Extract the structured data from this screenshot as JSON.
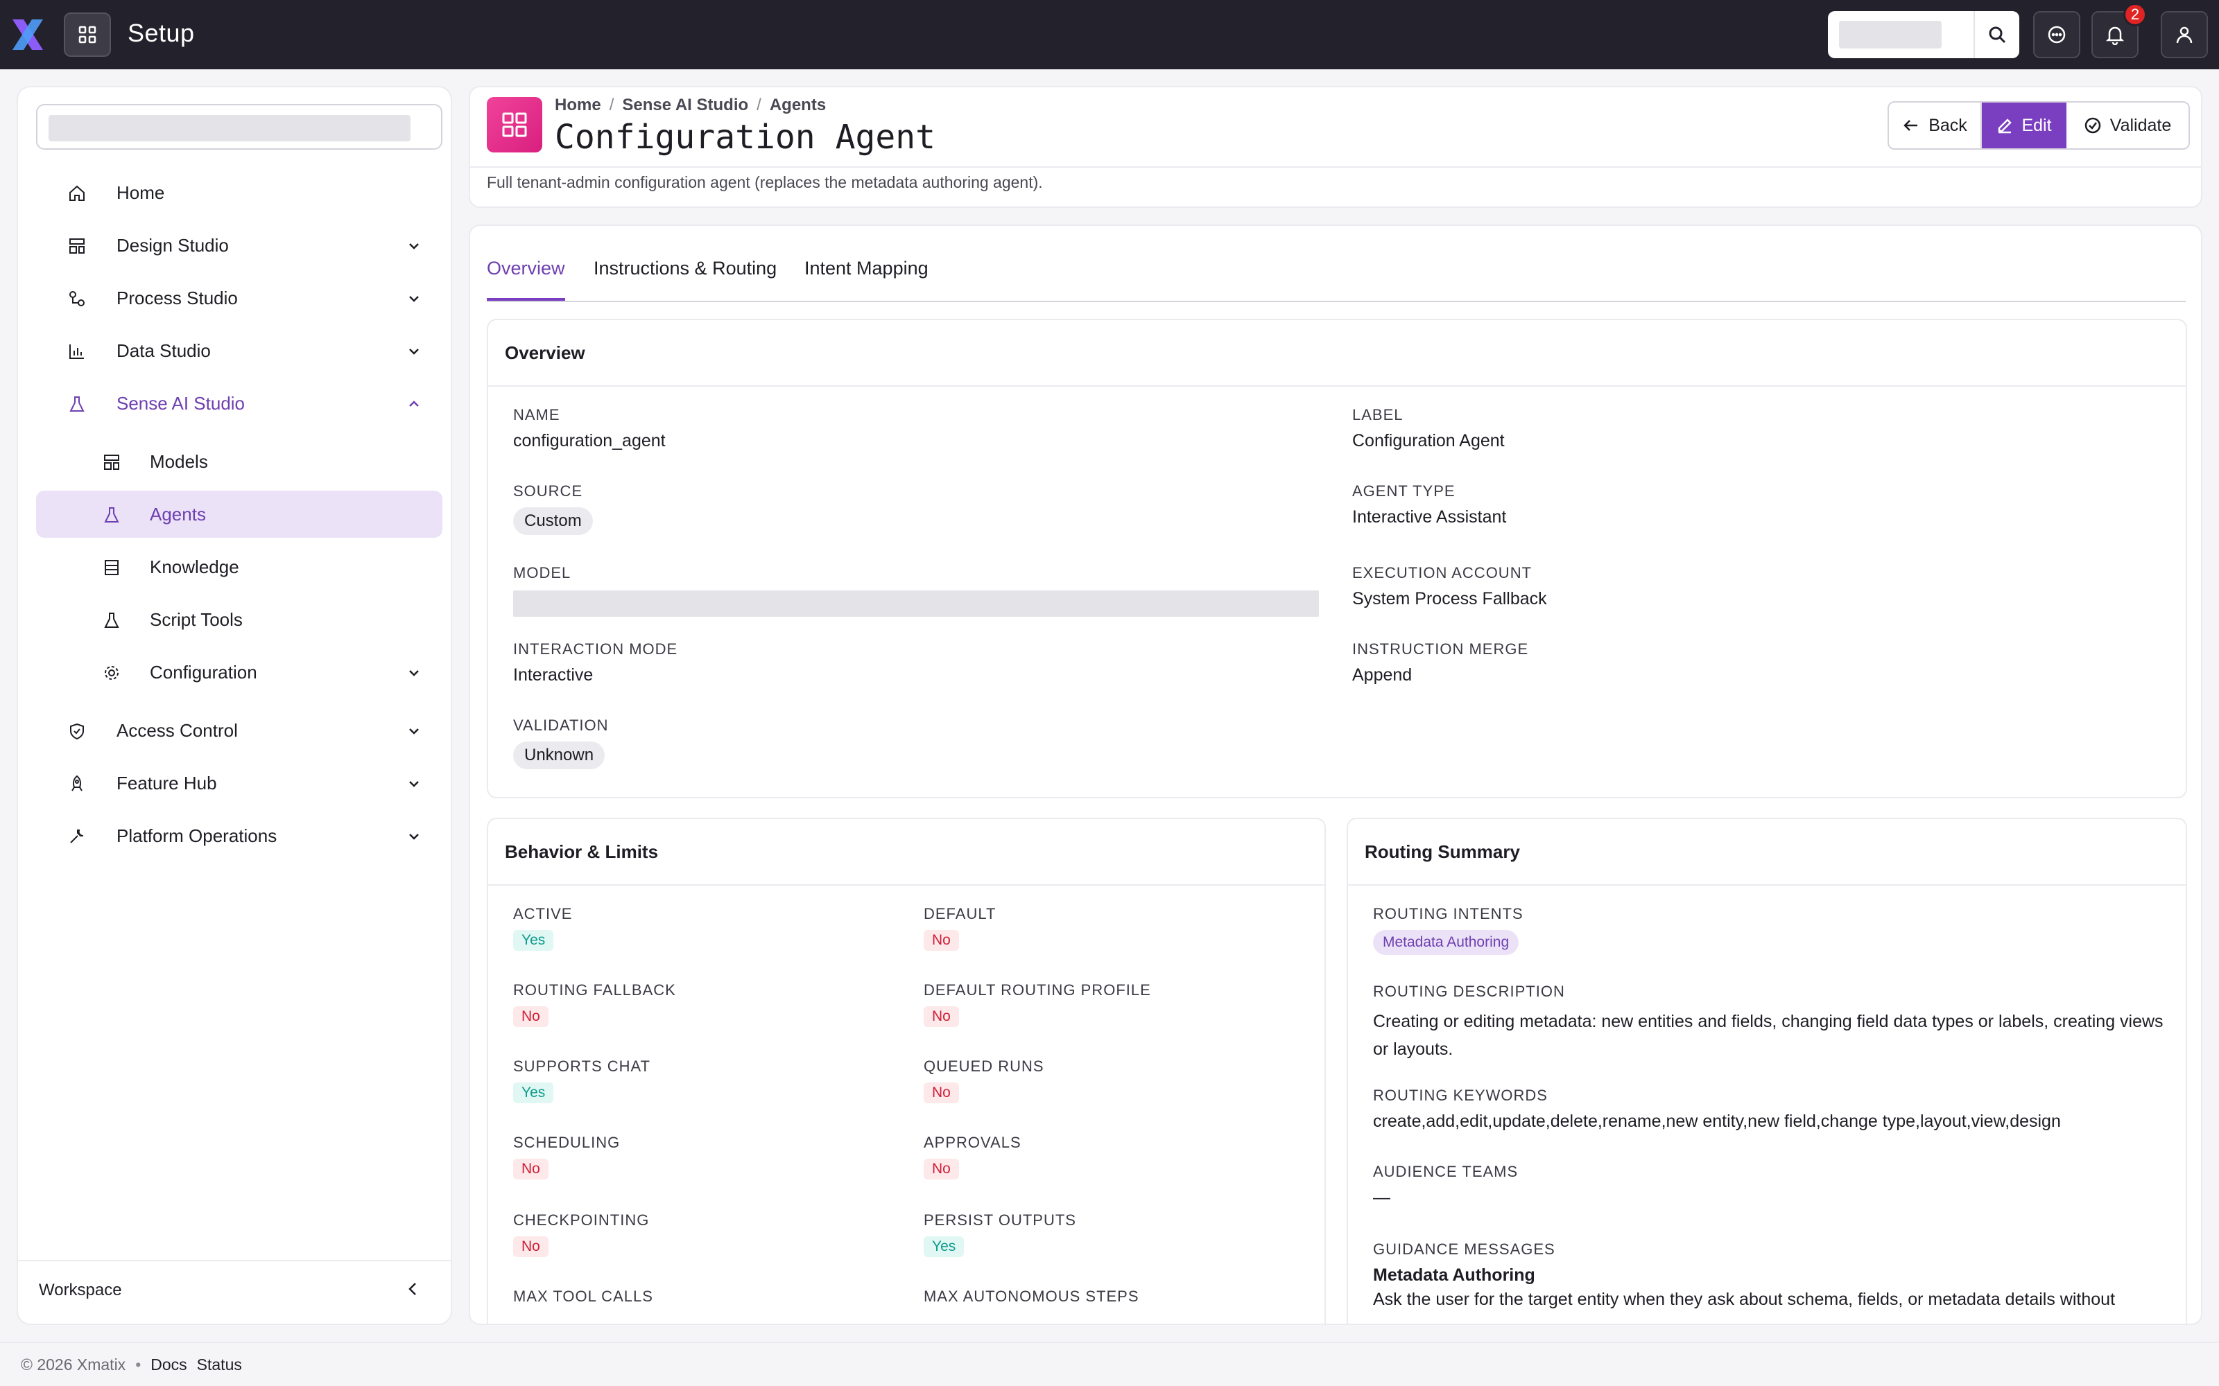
{
  "topbar": {
    "title": "Setup",
    "notifications_count": "2"
  },
  "sidebar": {
    "items": [
      {
        "label": "Home",
        "icon": "home-icon"
      },
      {
        "label": "Design Studio",
        "icon": "design-icon"
      },
      {
        "label": "Process Studio",
        "icon": "process-icon"
      },
      {
        "label": "Data Studio",
        "icon": "chart-icon"
      },
      {
        "label": "Sense AI Studio",
        "icon": "flask-icon"
      },
      {
        "label": "Models",
        "icon": "models-icon"
      },
      {
        "label": "Agents",
        "icon": "flask-icon"
      },
      {
        "label": "Knowledge",
        "icon": "knowledge-icon"
      },
      {
        "label": "Script Tools",
        "icon": "flask-icon"
      },
      {
        "label": "Configuration",
        "icon": "gear-icon"
      },
      {
        "label": "Access Control",
        "icon": "shield-icon"
      },
      {
        "label": "Feature Hub",
        "icon": "rocket-icon"
      },
      {
        "label": "Platform Operations",
        "icon": "wrench-icon"
      }
    ],
    "workspace_label": "Workspace"
  },
  "header": {
    "breadcrumb": [
      "Home",
      "Sense AI Studio",
      "Agents"
    ],
    "breadcrumb_separator": "/",
    "title": "Configuration Agent",
    "description": "Full tenant-admin configuration agent (replaces the metadata authoring agent).",
    "buttons": {
      "back": "Back",
      "edit": "Edit",
      "validate": "Validate"
    }
  },
  "tabs": [
    "Overview",
    "Instructions & Routing",
    "Intent Mapping"
  ],
  "overview": {
    "title": "Overview",
    "name_label": "NAME",
    "name_value": "configuration_agent",
    "label_label": "LABEL",
    "label_value": "Configuration Agent",
    "source_label": "SOURCE",
    "source_value": "Custom",
    "agent_type_label": "AGENT TYPE",
    "agent_type_value": "Interactive Assistant",
    "model_label": "MODEL",
    "execution_account_label": "EXECUTION ACCOUNT",
    "execution_account_value": "System Process Fallback",
    "interaction_mode_label": "INTERACTION MODE",
    "interaction_mode_value": "Interactive",
    "instruction_merge_label": "INSTRUCTION MERGE",
    "instruction_merge_value": "Append",
    "validation_label": "VALIDATION",
    "validation_value": "Unknown"
  },
  "behavior": {
    "title": "Behavior & Limits",
    "fields": [
      {
        "label": "ACTIVE",
        "value": "Yes"
      },
      {
        "label": "DEFAULT",
        "value": "No"
      },
      {
        "label": "ROUTING FALLBACK",
        "value": "No"
      },
      {
        "label": "DEFAULT ROUTING PROFILE",
        "value": "No"
      },
      {
        "label": "SUPPORTS CHAT",
        "value": "Yes"
      },
      {
        "label": "QUEUED RUNS",
        "value": "No"
      },
      {
        "label": "SCHEDULING",
        "value": "No"
      },
      {
        "label": "APPROVALS",
        "value": "No"
      },
      {
        "label": "CHECKPOINTING",
        "value": "No"
      },
      {
        "label": "PERSIST OUTPUTS",
        "value": "Yes"
      },
      {
        "label": "MAX TOOL CALLS",
        "value": ""
      },
      {
        "label": "MAX AUTONOMOUS STEPS",
        "value": ""
      }
    ]
  },
  "routing": {
    "title": "Routing Summary",
    "intents_label": "ROUTING INTENTS",
    "intents": [
      "Metadata Authoring"
    ],
    "description_label": "ROUTING DESCRIPTION",
    "description_value": "Creating or editing metadata: new entities and fields, changing field data types or labels, creating views or layouts.",
    "keywords_label": "ROUTING KEYWORDS",
    "keywords_value": "create,add,edit,update,delete,rename,new entity,new field,change type,layout,view,design",
    "audience_label": "AUDIENCE TEAMS",
    "audience_value": "—",
    "guidance_label": "GUIDANCE MESSAGES",
    "guidance_title": "Metadata Authoring",
    "guidance_text": "Ask the user for the target entity when they ask about schema, fields, or metadata details without"
  },
  "footer": {
    "copyright": "© 2026 Xmatix",
    "dot": "•",
    "docs": "Docs",
    "status": "Status"
  },
  "colors": {
    "topbar": "#23212b",
    "accent": "#7a3fc1",
    "badge": "#e02424",
    "agent_badge": "#e9328e",
    "yes": "#0f9b8e",
    "no": "#d01f36"
  }
}
